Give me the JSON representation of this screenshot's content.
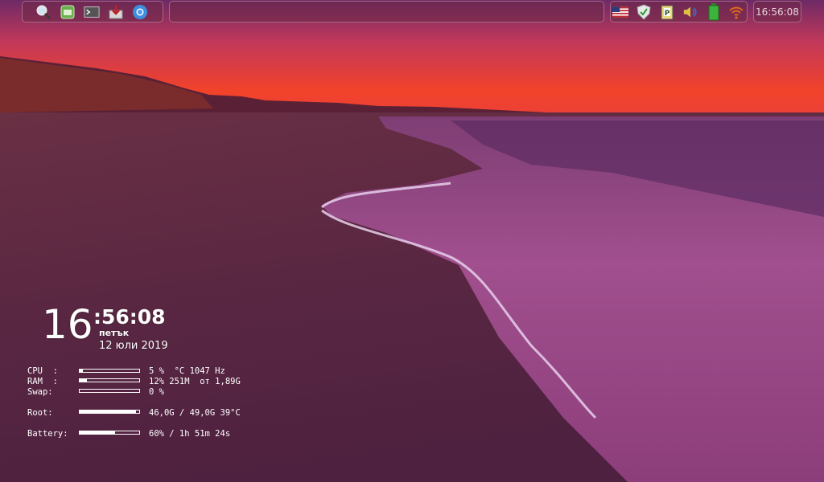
{
  "panel": {
    "launcher_icons": [
      "search-icon",
      "file-manager-icon",
      "terminal-icon",
      "installer-icon",
      "browser-icon"
    ],
    "tray_icons": [
      "us-flag-icon",
      "shield-icon",
      "clipboard-icon",
      "volume-icon",
      "battery-icon",
      "wifi-icon"
    ],
    "clock": "16:56:08"
  },
  "conky": {
    "hour": "16",
    "min_sec": ":56:08",
    "weekday": "петък",
    "date": "12 юли 2019",
    "stats": [
      {
        "label": "CPU  :",
        "value": "5 %  °C 1047 Hz",
        "level": 0.05
      },
      {
        "label": "RAM  :",
        "value": "12% 251M  от 1,89G",
        "level": 0.12
      },
      {
        "label": "Swap:",
        "value": "0 %",
        "level": 0.0
      },
      {
        "label": "Root:",
        "value": "46,0G / 49,0G 39°C",
        "level": 0.94
      },
      {
        "label": "Battery:",
        "value": "60% / 1h 51m 24s",
        "level": 0.6
      }
    ]
  },
  "colors": {
    "sky_top": "#7a2c6a",
    "sky_glow": "#f0402f",
    "sand": "#5e2a46",
    "sea": "#a24f8f"
  }
}
